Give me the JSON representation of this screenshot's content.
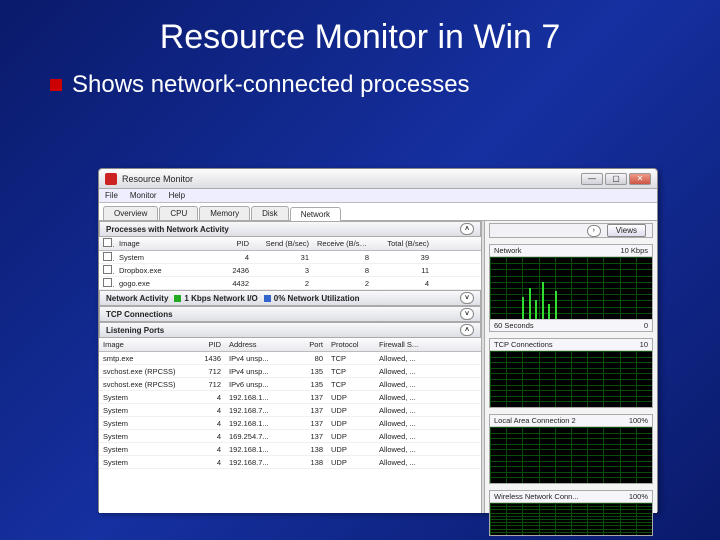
{
  "slide": {
    "title": "Resource Monitor in Win 7",
    "bullet": "Shows network-connected processes"
  },
  "app": {
    "title": "Resource Monitor",
    "menus": [
      "File",
      "Monitor",
      "Help"
    ],
    "tabs": [
      "Overview",
      "CPU",
      "Memory",
      "Disk",
      "Network"
    ],
    "active_tab": "Network"
  },
  "panels": {
    "proc": {
      "title": "Processes with Network Activity",
      "cols": {
        "image": "Image",
        "pid": "PID",
        "send": "Send (B/sec)",
        "recv": "Receive (B/sec)",
        "total": "Total (B/sec)"
      },
      "rows": [
        {
          "image": "System",
          "pid": "4",
          "send": "31",
          "recv": "8",
          "total": "39"
        },
        {
          "image": "Dropbox.exe",
          "pid": "2436",
          "send": "3",
          "recv": "8",
          "total": "11"
        },
        {
          "image": "gogo.exe",
          "pid": "4432",
          "send": "2",
          "recv": "2",
          "total": "4"
        }
      ]
    },
    "activity": {
      "title": "Network Activity",
      "legend1": "1 Kbps Network I/O",
      "legend2": "0% Network Utilization"
    },
    "tcp": {
      "title": "TCP Connections"
    },
    "listen": {
      "title": "Listening Ports",
      "cols": {
        "image": "Image",
        "pid": "PID",
        "addr": "Address",
        "port": "Port",
        "proto": "Protocol",
        "fw": "Firewall S..."
      },
      "rows": [
        {
          "image": "smtp.exe",
          "pid": "1436",
          "addr": "IPv4 unsp...",
          "port": "80",
          "proto": "TCP",
          "fw": "Allowed, ..."
        },
        {
          "image": "svchost.exe (RPCSS)",
          "pid": "712",
          "addr": "IPv4 unsp...",
          "port": "135",
          "proto": "TCP",
          "fw": "Allowed, ..."
        },
        {
          "image": "svchost.exe (RPCSS)",
          "pid": "712",
          "addr": "IPv6 unsp...",
          "port": "135",
          "proto": "TCP",
          "fw": "Allowed, ..."
        },
        {
          "image": "System",
          "pid": "4",
          "addr": "192.168.1...",
          "port": "137",
          "proto": "UDP",
          "fw": "Allowed, ..."
        },
        {
          "image": "System",
          "pid": "4",
          "addr": "192.168.7...",
          "port": "137",
          "proto": "UDP",
          "fw": "Allowed, ..."
        },
        {
          "image": "System",
          "pid": "4",
          "addr": "192.168.1...",
          "port": "137",
          "proto": "UDP",
          "fw": "Allowed, ..."
        },
        {
          "image": "System",
          "pid": "4",
          "addr": "169.254.7...",
          "port": "137",
          "proto": "UDP",
          "fw": "Allowed, ..."
        },
        {
          "image": "System",
          "pid": "4",
          "addr": "192.168.1...",
          "port": "138",
          "proto": "UDP",
          "fw": "Allowed, ..."
        },
        {
          "image": "System",
          "pid": "4",
          "addr": "192.168.7...",
          "port": "138",
          "proto": "UDP",
          "fw": "Allowed, ..."
        }
      ]
    }
  },
  "right": {
    "views": "Views",
    "g1": {
      "title": "Network",
      "right": "10 Kbps",
      "bl": "60 Seconds",
      "br": "0"
    },
    "g2": {
      "title": "TCP Connections",
      "right": "10"
    },
    "g3": {
      "title": "Local Area Connection 2",
      "right": "100%"
    },
    "g4": {
      "title": "Wireless Network Conn...",
      "right": "100%"
    }
  }
}
